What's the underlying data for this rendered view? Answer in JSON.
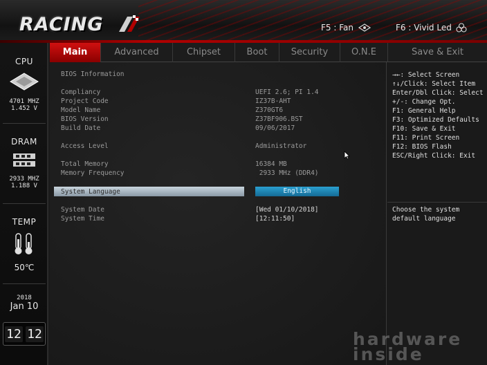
{
  "header": {
    "logo": "RACING",
    "f5_label": "F5 : Fan",
    "f6_label": "F6 : Vivid Led"
  },
  "sidebar": {
    "cpu": {
      "title": "CPU",
      "freq": "4701 MHZ",
      "volt": "1.452 V"
    },
    "dram": {
      "title": "DRAM",
      "freq": "2933 MHZ",
      "volt": "1.188 V"
    },
    "temp": {
      "title": "TEMP",
      "value": "50℃"
    },
    "date": {
      "year": "2018",
      "day": "Jan 10"
    },
    "clock": {
      "hour": "12",
      "minute": "12"
    }
  },
  "tabs": [
    {
      "label": "Main"
    },
    {
      "label": "Advanced"
    },
    {
      "label": "Chipset"
    },
    {
      "label": "Boot"
    },
    {
      "label": "Security"
    },
    {
      "label": "O.N.E"
    },
    {
      "label": "Save & Exit"
    }
  ],
  "main": {
    "section_title": "BIOS Information",
    "rows": [
      {
        "label": "Compliancy",
        "value": "UEFI 2.6; PI 1.4"
      },
      {
        "label": "Project Code",
        "value": "IZ37B-AHT"
      },
      {
        "label": "Model Name",
        "value": "Z370GT6"
      },
      {
        "label": "BIOS Version",
        "value": "Z37BF906.BST"
      },
      {
        "label": "Build Date",
        "value": "09/06/2017"
      },
      {
        "label": "Access Level",
        "value": "Administrator"
      },
      {
        "label": "Total Memory",
        "value": "16384 MB"
      },
      {
        "label": "Memory Frequency",
        "value": " 2933 MHz (DDR4)"
      }
    ],
    "language": {
      "label": "System Language",
      "value": "English"
    },
    "system_date": {
      "label": "System Date",
      "value": "[Wed 01/10/2018]"
    },
    "system_time": {
      "label": "System Time",
      "value": "[12:11:50]"
    }
  },
  "help": {
    "keys": [
      "→←: Select Screen",
      "↑↓/Click: Select Item",
      "Enter/Dbl Click: Select",
      "+/-: Change Opt.",
      "F1: General Help",
      "F3: Optimized Defaults",
      "F10: Save & Exit",
      "F11: Print Screen",
      "F12: BIOS Flash",
      "ESC/Right Click: Exit"
    ],
    "description": "Choose the system default language"
  },
  "watermark": {
    "line1": "hardware",
    "line2": "inside"
  },
  "colors": {
    "accent": "#c00000",
    "select_blue": "#1f8bbd"
  }
}
